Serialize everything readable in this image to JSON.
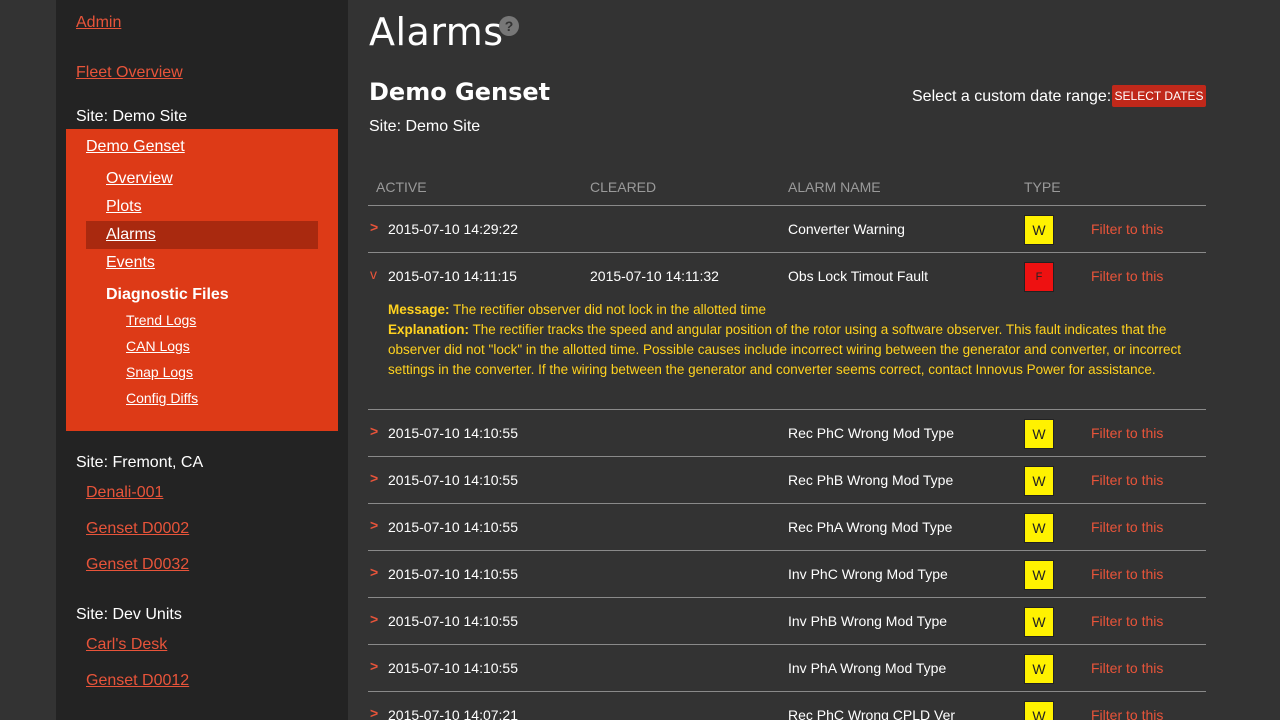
{
  "sidebar": {
    "admin": "Admin",
    "fleet_overview": "Fleet Overview",
    "site_demo": "Site: Demo Site",
    "demo_genset": "Demo Genset",
    "nav": [
      "Overview",
      "Plots",
      "Alarms",
      "Events"
    ],
    "diagnostic_files": "Diagnostic Files",
    "diag_items": [
      "Trend Logs",
      "CAN Logs",
      "Snap Logs",
      "Config Diffs"
    ],
    "site_fremont": "Site: Fremont, CA",
    "fremont_items": [
      "Denali-001",
      "Genset D0002",
      "Genset D0032"
    ],
    "site_dev": "Site: Dev Units",
    "dev_items": [
      "Carl's Desk",
      "Genset D0012"
    ]
  },
  "header": {
    "title": "Alarms",
    "help_icon": "?",
    "genset": "Demo Genset",
    "site": "Site: Demo Site",
    "date_range_label": "Select a custom date range:",
    "select_dates": "SELECT DATES"
  },
  "table": {
    "columns": [
      "ACTIVE",
      "CLEARED",
      "ALARM NAME",
      "TYPE"
    ],
    "filter_label": "Filter to this",
    "rows": [
      {
        "chev": ">",
        "active": "2015-07-10 14:29:22",
        "cleared": "",
        "name": "Converter Warning",
        "type": "W"
      },
      {
        "chev": "v",
        "active": "2015-07-10 14:11:15",
        "cleared": "2015-07-10 14:11:32",
        "name": "Obs Lock Timout Fault",
        "type": "F"
      },
      {
        "chev": ">",
        "active": "2015-07-10 14:10:55",
        "cleared": "",
        "name": "Rec PhC Wrong Mod Type",
        "type": "W"
      },
      {
        "chev": ">",
        "active": "2015-07-10 14:10:55",
        "cleared": "",
        "name": "Rec PhB Wrong Mod Type",
        "type": "W"
      },
      {
        "chev": ">",
        "active": "2015-07-10 14:10:55",
        "cleared": "",
        "name": "Rec PhA Wrong Mod Type",
        "type": "W"
      },
      {
        "chev": ">",
        "active": "2015-07-10 14:10:55",
        "cleared": "",
        "name": "Inv PhC Wrong Mod Type",
        "type": "W"
      },
      {
        "chev": ">",
        "active": "2015-07-10 14:10:55",
        "cleared": "",
        "name": "Inv PhB Wrong Mod Type",
        "type": "W"
      },
      {
        "chev": ">",
        "active": "2015-07-10 14:10:55",
        "cleared": "",
        "name": "Inv PhA Wrong Mod Type",
        "type": "W"
      },
      {
        "chev": ">",
        "active": "2015-07-10 14:07:21",
        "cleared": "",
        "name": "Rec PhC Wrong CPLD Ver",
        "type": "W"
      }
    ],
    "detail": {
      "message_label": "Message:",
      "message": "The rectifier observer did not lock in the allotted time",
      "explanation_label": "Explanation:",
      "explanation": "The rectifier tracks the speed and angular position of the rotor using a software observer. This fault indicates that the observer did not \"lock\" in the allotted time. Possible causes include incorrect wiring between the generator and converter, or incorrect settings in the converter. If the wiring between the generator and converter seems correct, contact Innovus Power for assistance."
    }
  },
  "colors": {
    "accent": "#e8543a",
    "site_box": "#dd3a17",
    "warning": "#fff200",
    "fault": "#ee1111",
    "detail_text": "#ffd21f"
  }
}
